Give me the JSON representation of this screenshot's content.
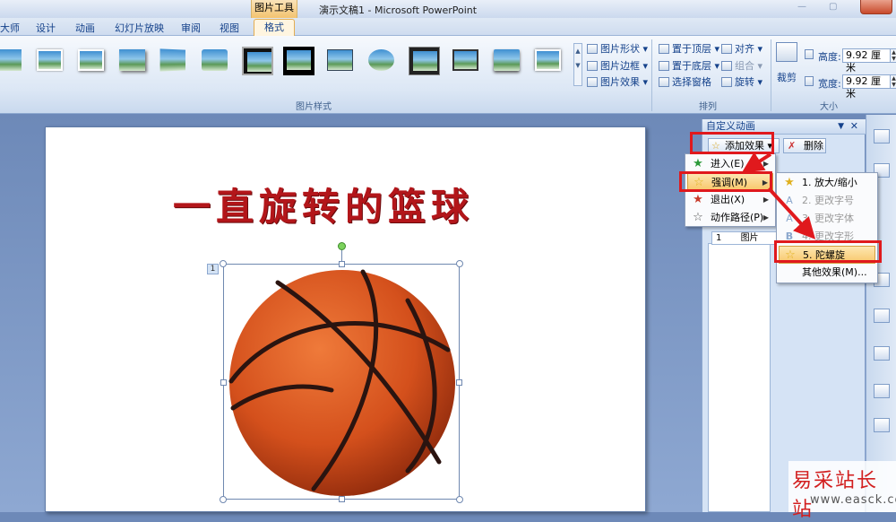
{
  "window": {
    "context_tab": "图片工具",
    "title": "演示文稿1 - Microsoft PowerPoint"
  },
  "tabs": [
    "大师",
    "设计",
    "动画",
    "幻灯片放映",
    "审阅",
    "视图",
    "格式"
  ],
  "ribbon": {
    "picture_styles_label": "图片样式",
    "picture_shape": "图片形状",
    "picture_border": "图片边框",
    "picture_effects": "图片效果",
    "bring_to_front": "置于顶层",
    "send_to_back": "置于底层",
    "selection_pane": "选择窗格",
    "align": "对齐",
    "group": "组合",
    "rotate": "旋转",
    "arrange_label": "排列",
    "crop": "裁剪",
    "height_label": "高度:",
    "height_value": "9.92 厘米",
    "width_label": "宽度:",
    "width_value": "9.92 厘米",
    "size_label": "大小"
  },
  "slide": {
    "title": "一直旋转的篮球",
    "anim_tag": "1"
  },
  "pane": {
    "title": "自定义动画",
    "add_effect": "添加效果",
    "delete": "删除",
    "list_item_num": "1",
    "list_item_label": "图片"
  },
  "menu_main": [
    {
      "label": "进入(E)",
      "icon": "enter-star-icon"
    },
    {
      "label": "强调(M)",
      "icon": "emphasis-star-icon"
    },
    {
      "label": "退出(X)",
      "icon": "exit-star-icon"
    },
    {
      "label": "动作路径(P)",
      "icon": "motion-path-star-icon"
    }
  ],
  "menu_sub": [
    {
      "label": "1. 放大/缩小"
    },
    {
      "label": "2. 更改字号"
    },
    {
      "label": "3. 更改字体"
    },
    {
      "label": "4. 更改字形"
    },
    {
      "label": "5. 陀螺旋"
    },
    {
      "label": "其他效果(M)..."
    }
  ],
  "watermark": {
    "text": "易采站长站",
    "url": "www.easck.com"
  },
  "colors": {
    "highlight": "#f8c76a",
    "red_annotation": "#e0191d",
    "title_red": "#b3161a",
    "ball_orange": "#d4501c"
  }
}
